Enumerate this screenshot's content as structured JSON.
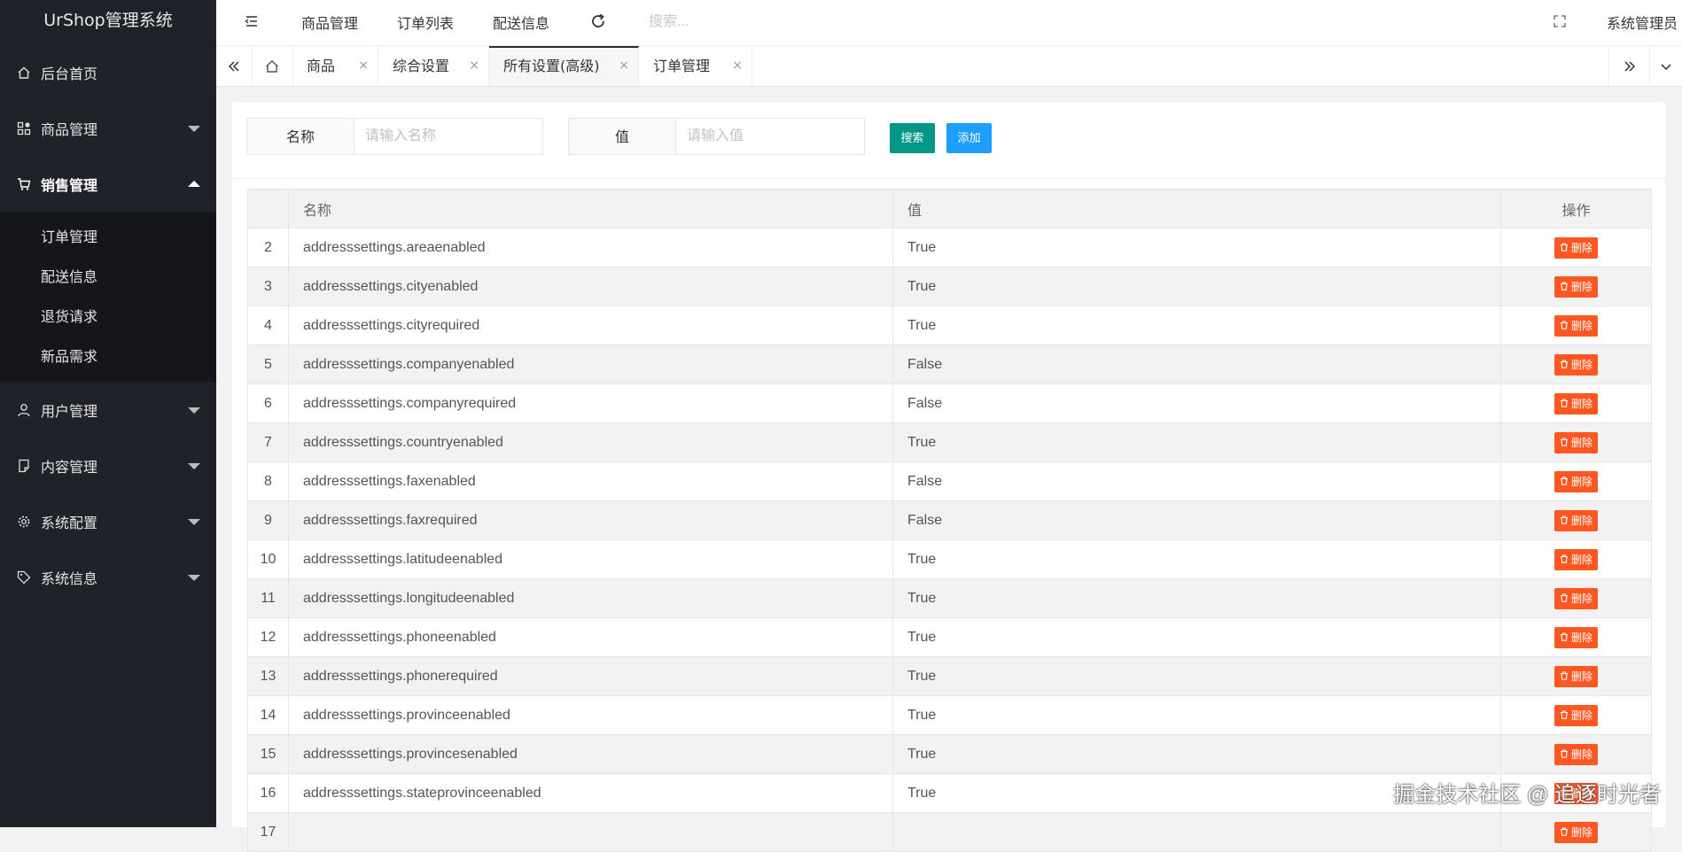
{
  "sidebar": {
    "title": "UrShop管理系统",
    "items": [
      {
        "label": "后台首页",
        "icon": "home-icon"
      },
      {
        "label": "商品管理",
        "icon": "product-icon"
      },
      {
        "label": "销售管理",
        "icon": "cart-icon"
      },
      {
        "label": "用户管理",
        "icon": "user-icon"
      },
      {
        "label": "内容管理",
        "icon": "content-icon"
      },
      {
        "label": "系统配置",
        "icon": "gear-icon"
      },
      {
        "label": "系统信息",
        "icon": "tag-icon"
      }
    ],
    "sales_submenu": [
      "订单管理",
      "配送信息",
      "退货请求",
      "新品需求"
    ]
  },
  "header": {
    "links": [
      "商品管理",
      "订单列表",
      "配送信息"
    ],
    "search_placeholder": "搜索...",
    "user": "系统管理员"
  },
  "tabs": [
    {
      "label": "商品",
      "close": "×"
    },
    {
      "label": "综合设置",
      "close": "×"
    },
    {
      "label": "所有设置(高级)",
      "close": "×",
      "active": true
    },
    {
      "label": "订单管理",
      "close": "×"
    }
  ],
  "filter": {
    "name_label": "名称",
    "name_placeholder": "请输入名称",
    "value_label": "值",
    "value_placeholder": "请输入值",
    "search_btn": "搜索",
    "add_btn": "添加"
  },
  "table": {
    "headers": [
      "",
      "名称",
      "值",
      "操作"
    ],
    "delete_label": "删除",
    "rows": [
      {
        "idx": "2",
        "name": "addresssettings.areaenabled",
        "value": "True"
      },
      {
        "idx": "3",
        "name": "addresssettings.cityenabled",
        "value": "True"
      },
      {
        "idx": "4",
        "name": "addresssettings.cityrequired",
        "value": "True"
      },
      {
        "idx": "5",
        "name": "addresssettings.companyenabled",
        "value": "False"
      },
      {
        "idx": "6",
        "name": "addresssettings.companyrequired",
        "value": "False"
      },
      {
        "idx": "7",
        "name": "addresssettings.countryenabled",
        "value": "True"
      },
      {
        "idx": "8",
        "name": "addresssettings.faxenabled",
        "value": "False"
      },
      {
        "idx": "9",
        "name": "addresssettings.faxrequired",
        "value": "False"
      },
      {
        "idx": "10",
        "name": "addresssettings.latitudeenabled",
        "value": "True"
      },
      {
        "idx": "11",
        "name": "addresssettings.longitudeenabled",
        "value": "True"
      },
      {
        "idx": "12",
        "name": "addresssettings.phoneenabled",
        "value": "True"
      },
      {
        "idx": "13",
        "name": "addresssettings.phonerequired",
        "value": "True"
      },
      {
        "idx": "14",
        "name": "addresssettings.provinceenabled",
        "value": "True"
      },
      {
        "idx": "15",
        "name": "addresssettings.provincesenabled",
        "value": "True"
      },
      {
        "idx": "16",
        "name": "addresssettings.stateprovinceenabled",
        "value": "True"
      },
      {
        "idx": "17",
        "name": "",
        "value": ""
      }
    ]
  },
  "watermark": "掘金技术社区 @ 追逐时光者",
  "colors": {
    "sidebar_bg": "#20222a",
    "submenu_bg": "#15161b",
    "search_btn": "#009688",
    "add_btn": "#1e9fff",
    "delete_btn": "#ff5722"
  }
}
